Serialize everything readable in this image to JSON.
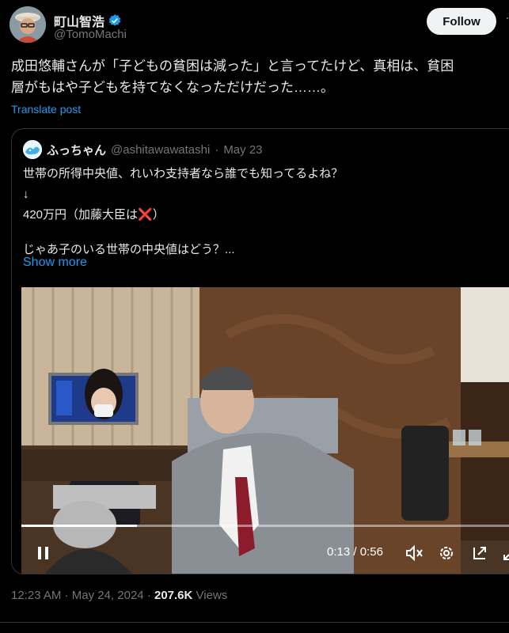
{
  "author": {
    "display_name": "町山智浩",
    "handle": "@TomoMachi"
  },
  "follow_label": "Follow",
  "more_glyph": "·",
  "post": {
    "line1": "成田悠輔さんが「子どもの貧困は減った」と言ってたけど、真相は、貧困",
    "line2": "層がもはや子どもを持てなくなっただけだった……。",
    "translate_label": "Translate post"
  },
  "quote": {
    "display_name": "ふっちゃん",
    "handle": "@ashitawawatashi",
    "sep": "·",
    "date": "May 23",
    "lines": [
      "世帯の所得中央値、れいわ支持者なら誰でも知ってるよね？",
      "↓",
      "420万円（加藤大臣は",
      "）",
      "じゃあ子のいる世帯の中央値はどう？..."
    ],
    "cross_emoji": "❌",
    "show_more": "Show more"
  },
  "video": {
    "progress": 0.232,
    "time_current": "0:13",
    "time_sep": "/",
    "time_total": "0:56",
    "icons": [
      "pause-icon",
      "mute-icon",
      "settings-icon",
      "pip-icon",
      "fullscreen-icon"
    ]
  },
  "meta": {
    "time": "12:23 AM",
    "dot1": "·",
    "date": "May 24, 2024",
    "dot2": "·",
    "views_count": "207.6K",
    "views_label": "Views"
  },
  "colors": {
    "background": "#000000",
    "text": "#e7e9ea",
    "muted": "#71767b",
    "link": "#1d9bf0",
    "verified": "#1d9bf0"
  }
}
